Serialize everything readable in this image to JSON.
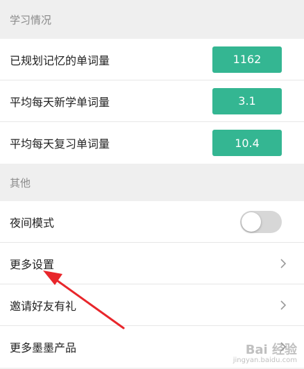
{
  "study": {
    "header": "学习情况",
    "rows": [
      {
        "label": "已规划记忆的单词量",
        "value": "1162"
      },
      {
        "label": "平均每天新学单词量",
        "value": "3.1"
      },
      {
        "label": "平均每天复习单词量",
        "value": "10.4"
      }
    ]
  },
  "other": {
    "header": "其他",
    "night_mode": {
      "label": "夜间模式",
      "enabled": false,
      "icon": "toggle-switch"
    },
    "more_settings": {
      "label": "更多设置",
      "icon": "chevron-right-icon"
    },
    "invite": {
      "label": "邀请好友有礼",
      "icon": "chevron-right-icon"
    },
    "more_products": {
      "label": "更多墨墨产品",
      "icon": "chevron-right-icon"
    }
  },
  "annotation": {
    "type": "arrow",
    "color": "#e8262b"
  },
  "watermark": {
    "brand": "Bai 经验",
    "url": "jingyan.baidu.com"
  },
  "colors": {
    "accent": "#34b692",
    "background": "#f2f2f2"
  }
}
